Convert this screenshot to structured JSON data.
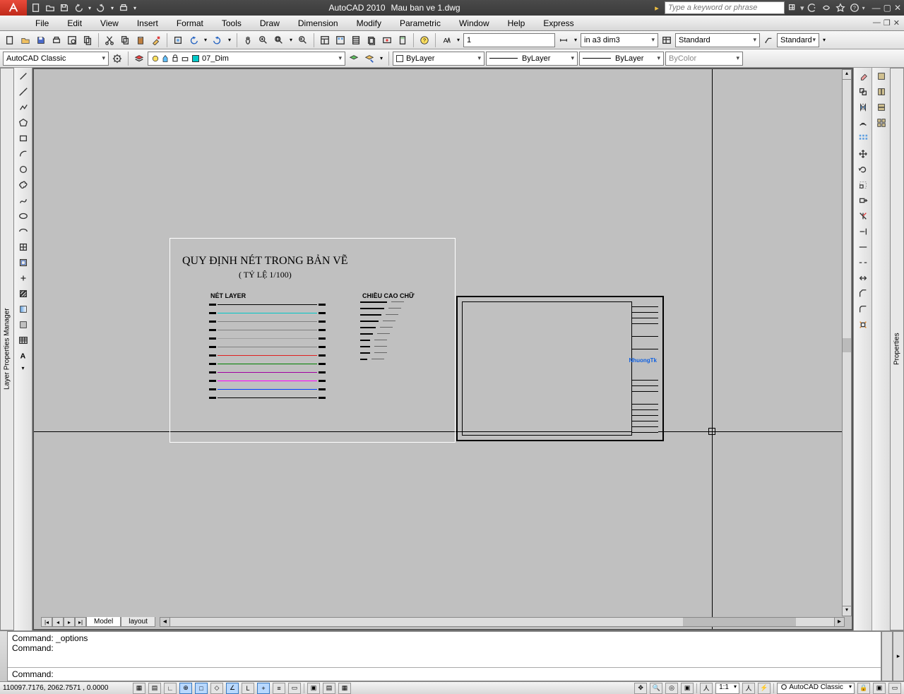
{
  "title": {
    "app": "AutoCAD 2010",
    "file": "Mau ban ve 1.dwg"
  },
  "search": {
    "placeholder": "Type a keyword or phrase"
  },
  "menu": [
    "File",
    "Edit",
    "View",
    "Insert",
    "Format",
    "Tools",
    "Draw",
    "Dimension",
    "Modify",
    "Parametric",
    "Window",
    "Help",
    "Express"
  ],
  "tb1": {
    "annotation_input": "1",
    "dimstyle": "in a3 dim3",
    "textstyle": "Standard",
    "tablestyle": "Standard"
  },
  "tb2": {
    "workspace": "AutoCAD Classic",
    "layer": "07_Dim",
    "color": "ByLayer",
    "linetype": "ByLayer",
    "lineweight": "ByLayer",
    "plotstyle": "ByColor"
  },
  "side": {
    "left": "Layer Properties Manager",
    "right": "Properties"
  },
  "drawing": {
    "title": "QUY ĐỊNH NÉT TRONG BẢN VẼ",
    "subtitle": "( TỶ LỆ 1/100)",
    "net_layer": "NÉT LAYER",
    "chieu_cao": "CHIỀU CAO CHỮ",
    "title_block_name": "NhuongTk",
    "layer_colors": [
      "#000000",
      "#00c8c8",
      "#808080",
      "#808080",
      "#a0a0a0",
      "#808080",
      "#e02020",
      "#008000",
      "#a000a0",
      "#ff00ff",
      "#0040ff",
      "#000000"
    ],
    "text_heights": [
      38,
      34,
      30,
      26,
      22,
      18,
      14,
      14,
      14,
      10
    ]
  },
  "tabs": {
    "model": "Model",
    "layout": "layout"
  },
  "command": {
    "history": [
      "Command: _options",
      "Command:"
    ],
    "prompt": "Command:"
  },
  "status": {
    "coords": "110097.7176, 2062.7571 , 0.0000",
    "toggles": [
      "SNAP",
      "GRID",
      "ORTHO",
      "POLAR",
      "OSNAP",
      "3DOSNAP",
      "OTRACK",
      "DUCS",
      "DYN",
      "LWT",
      "QP"
    ],
    "scale": "1:1",
    "workspace": "AutoCAD Classic"
  }
}
